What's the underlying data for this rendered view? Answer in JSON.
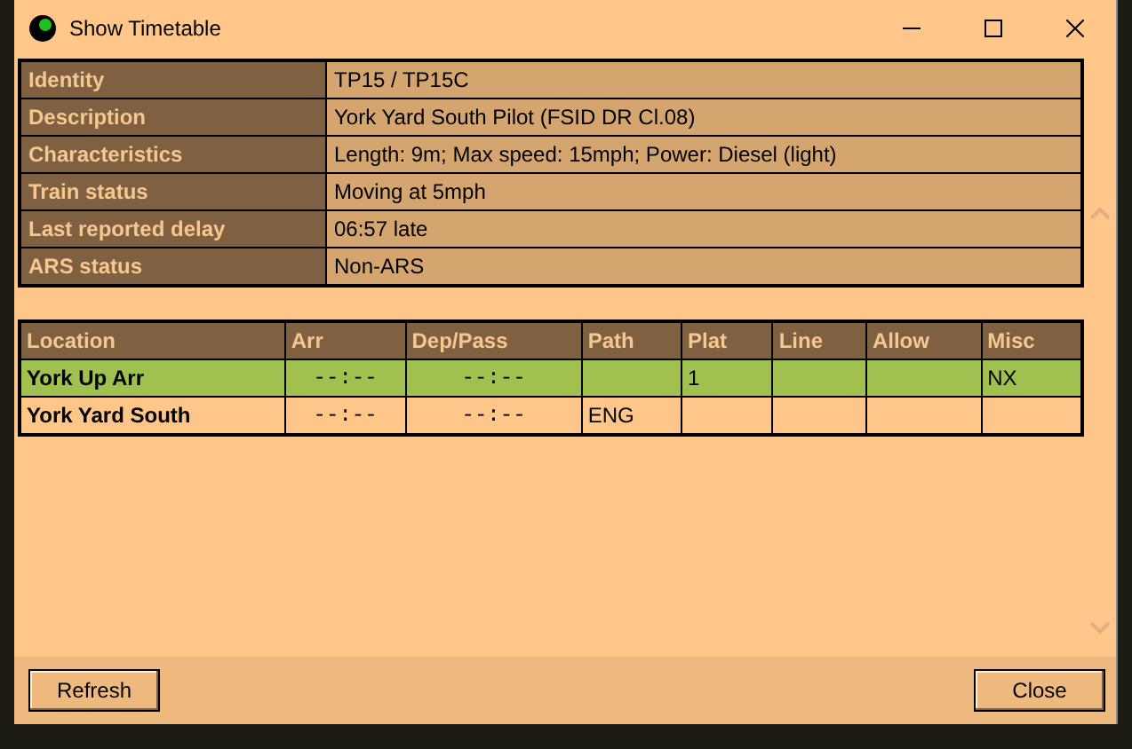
{
  "window": {
    "title": "Show Timetable"
  },
  "details": [
    {
      "label": "Identity",
      "value": "TP15 / TP15C"
    },
    {
      "label": "Description",
      "value": "York Yard South Pilot (FSID DR Cl.08)"
    },
    {
      "label": "Characteristics",
      "value": "Length: 9m; Max speed: 15mph; Power: Diesel (light)"
    },
    {
      "label": "Train status",
      "value": "Moving at 5mph"
    },
    {
      "label": "Last reported delay",
      "value": "06:57 late"
    },
    {
      "label": "ARS status",
      "value": "Non-ARS"
    }
  ],
  "timetable": {
    "columns": [
      "Location",
      "Arr",
      "Dep/Pass",
      "Path",
      "Plat",
      "Line",
      "Allow",
      "Misc"
    ],
    "rows": [
      {
        "selected": true,
        "cells": [
          "York Up Arr",
          "--:--",
          "--:--",
          "",
          "1",
          "",
          "",
          "NX"
        ]
      },
      {
        "selected": false,
        "cells": [
          "York Yard South",
          "--:--",
          "--:--",
          "ENG",
          "",
          "",
          "",
          ""
        ]
      }
    ]
  },
  "buttons": [
    {
      "label": "Refresh"
    },
    {
      "label": "Close"
    }
  ]
}
